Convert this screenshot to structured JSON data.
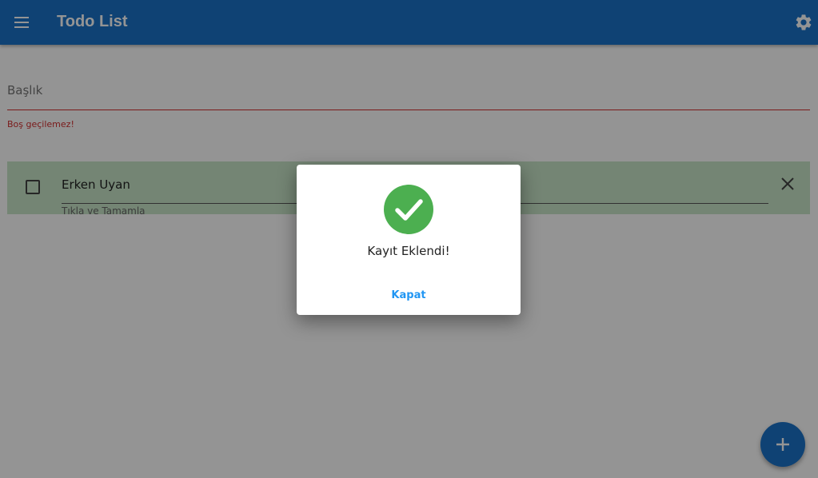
{
  "app": {
    "title": "Todo List"
  },
  "form": {
    "title_label": "Başlık",
    "error_text": "Boş geçilemez!"
  },
  "todos": [
    {
      "text": "Erken Uyan",
      "hint": "Tıkla ve Tamamla",
      "checked": false
    }
  ],
  "dialog": {
    "message": "Kayıt Eklendi!",
    "close_label": "Kapat"
  },
  "icons": {
    "menu": "menu-icon",
    "settings": "gear-icon",
    "close": "close-icon",
    "add": "plus-icon",
    "success": "check-icon"
  },
  "colors": {
    "primary": "#1a73c9",
    "error": "#d32f2f",
    "todo_bg": "#c8e6c9",
    "success": "#4caf50",
    "dialog_button": "#2196f3"
  }
}
